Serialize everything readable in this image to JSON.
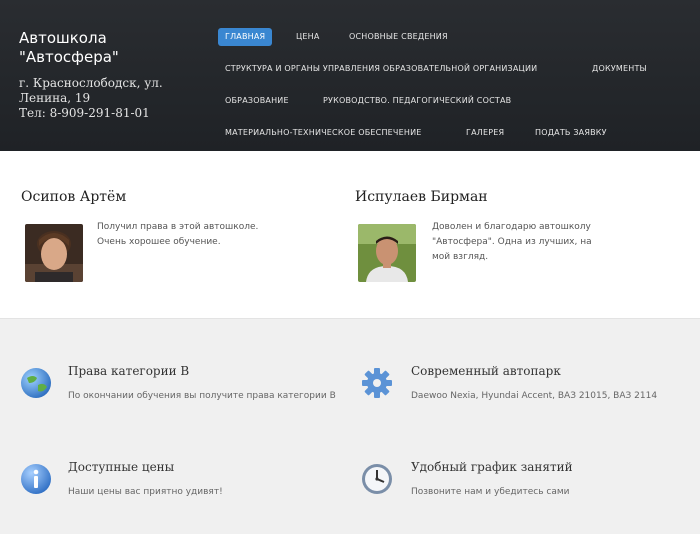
{
  "brand": {
    "name_line1": "Автошкола",
    "name_line2": "\"Автосфера\"",
    "address_line1": "г. Краснослободск, ул.",
    "address_line2": "Ленина, 19",
    "phone": "Тел: 8-909-291-81-01"
  },
  "nav": [
    {
      "label": "Главная",
      "active": true
    },
    {
      "label": "Цена"
    },
    {
      "label": "Основные сведения"
    },
    {
      "label": "Структура и органы управления образовательной организации"
    },
    {
      "label": "Документы"
    },
    {
      "label": "Образование"
    },
    {
      "label": "Руководство. Педагогический состав"
    },
    {
      "label": "Материально-техническое обеспечение"
    },
    {
      "label": "Галерея"
    },
    {
      "label": "Подать заявку"
    }
  ],
  "testimonials": [
    {
      "name": "Осипов Артём",
      "text": "Получил права в этой автошколе. Очень хорошее обучение."
    },
    {
      "name": "Испулаев Бирман",
      "text": "Доволен и благодарю автошколу \"Автосфера\". Одна из лучших, на мой взгляд."
    }
  ],
  "features": [
    {
      "title": "Права категории B",
      "text": "По окончании обучения вы получите права категории B",
      "icon": "globe-icon"
    },
    {
      "title": "Современный автопарк",
      "text": "Daewoo Nexia, Hyundai Accent, ВАЗ 21015, ВАЗ 2114",
      "icon": "gear-icon"
    },
    {
      "title": "Доступные цены",
      "text": "Наши цены вас приятно удивят!",
      "icon": "info-icon"
    },
    {
      "title": "Удобный график занятий",
      "text": "Позвоните нам и убедитесь сами",
      "icon": "clock-icon"
    }
  ],
  "colors": {
    "accent": "#3a87d1",
    "header_bg": "#25282c"
  }
}
